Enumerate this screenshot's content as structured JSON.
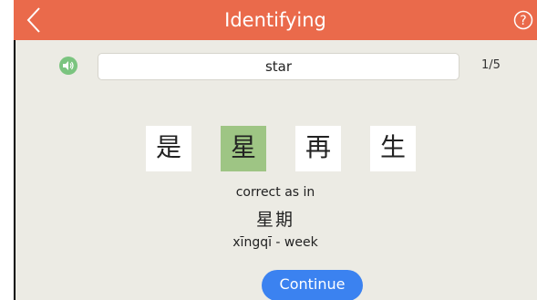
{
  "header": {
    "title": "Identifying",
    "back_icon": "chevron-left-icon",
    "help_icon": "question-circle-icon",
    "color": "#ea6a4b"
  },
  "prompt": {
    "audio_icon": "speaker-icon",
    "word": "star",
    "progress": "1/5"
  },
  "choices": [
    {
      "char": "是",
      "selected": false
    },
    {
      "char": "星",
      "selected": true
    },
    {
      "char": "再",
      "selected": false
    },
    {
      "char": "生",
      "selected": false
    }
  ],
  "feedback": {
    "line1": "correct as in",
    "example_chars": "星期",
    "example_pinyin": "xīngqī - week"
  },
  "continue_label": "Continue",
  "colors": {
    "background": "#ecebe4",
    "selected_card": "#9ec584",
    "continue_button": "#3b82f0",
    "speaker": "#7bc47f"
  }
}
